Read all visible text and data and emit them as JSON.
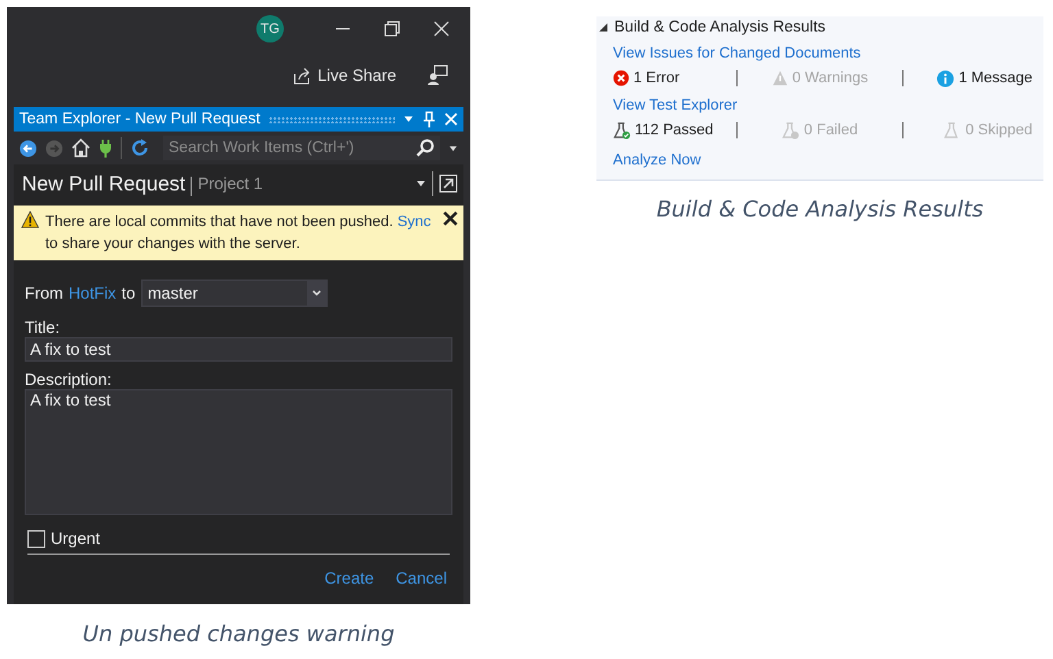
{
  "left_figure": {
    "window": {
      "avatar": "TG"
    },
    "live_share": "Live Share",
    "tool_window": {
      "title": "Team Explorer - New Pull Request",
      "search": {
        "placeholder": "Search Work Items (Ctrl+')"
      },
      "page_title": "New Pull Request",
      "project": "Project 1",
      "warning": {
        "text": "There are local commits that have not been pushed.",
        "link": "Sync",
        "rest": "to share your changes with the server."
      },
      "form": {
        "from_label": "From",
        "source_branch": "HotFix",
        "to_label": "to",
        "target_branch": "master",
        "title_label": "Title:",
        "title_value": "A fix to test",
        "description_label": "Description:",
        "description_value": "A fix to test",
        "urgent": {
          "label": "Urgent",
          "checked": false
        }
      },
      "actions": [
        "Create",
        "Cancel"
      ]
    },
    "caption": "Un pushed changes warning"
  },
  "right_figure": {
    "section": {
      "title": "Build & Code Analysis Results",
      "expanded": true
    },
    "groups": [
      {
        "link": "View Issues for Changed Documents",
        "stats": [
          {
            "kind": "error",
            "text": "1 Error",
            "disabled": false
          },
          {
            "kind": "warning",
            "text": "0 Warnings",
            "disabled": true
          },
          {
            "kind": "info",
            "text": "1 Message",
            "disabled": false
          }
        ]
      },
      {
        "link": "View Test Explorer",
        "stats": [
          {
            "kind": "passed",
            "text": "112 Passed",
            "disabled": false
          },
          {
            "kind": "failed",
            "text": "0 Failed",
            "disabled": true
          },
          {
            "kind": "skipped",
            "text": "0 Skipped",
            "disabled": true
          }
        ]
      }
    ],
    "analyze_link": "Analyze Now",
    "caption": "Build & Code Analysis Results"
  }
}
